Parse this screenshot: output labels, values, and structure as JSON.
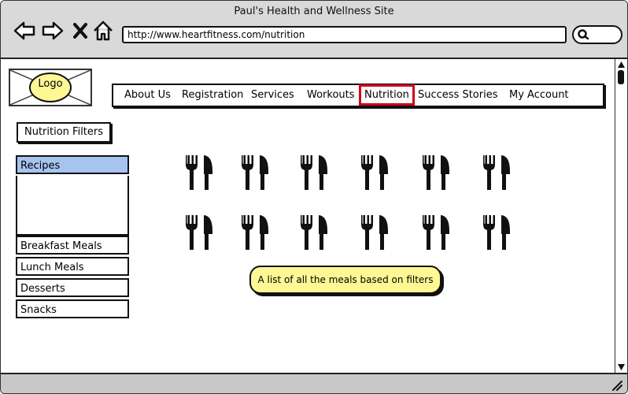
{
  "browser": {
    "title": "Paul's Health and Wellness Site",
    "url": "http://www.heartfitness.com/nutrition",
    "icons": [
      "back-arrow-icon",
      "forward-arrow-icon",
      "close-icon",
      "home-icon",
      "search-icon"
    ]
  },
  "header": {
    "logo_label": "Logo"
  },
  "nav": {
    "items": [
      {
        "label": "About Us"
      },
      {
        "label": "Registration"
      },
      {
        "label": "Services"
      },
      {
        "label": "Workouts"
      },
      {
        "label": "Nutrition",
        "active": true
      },
      {
        "label": "Success Stories"
      },
      {
        "label": "My Account"
      }
    ],
    "active_color": "#d0021b"
  },
  "filters": {
    "title": "Nutrition Filters",
    "categories": [
      {
        "label": "Recipes",
        "selected": true
      },
      {
        "label": "Breakfast Meals"
      },
      {
        "label": "Lunch Meals"
      },
      {
        "label": "Desserts"
      },
      {
        "label": "Snacks"
      }
    ],
    "selected_color": "#a7c4f0"
  },
  "meals": {
    "icon": "fork-knife-icon",
    "rows": 2,
    "columns": 6,
    "note": "A list of all the meals based on filters",
    "note_color": "#fff794"
  }
}
